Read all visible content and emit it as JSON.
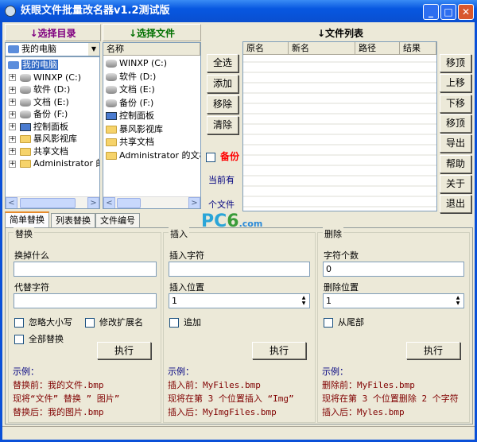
{
  "window": {
    "title": "妖眼文件批量改名器v1.2测试版"
  },
  "dir_panel": {
    "header": "↓选择目录",
    "combo": "我的电脑",
    "tree": [
      {
        "label": "我的电脑",
        "type": "pc"
      },
      {
        "label": "WINXP (C:)",
        "type": "drive"
      },
      {
        "label": "软件 (D:)",
        "type": "drive"
      },
      {
        "label": "文档 (E:)",
        "type": "drive"
      },
      {
        "label": "备份 (F:)",
        "type": "drive"
      },
      {
        "label": "控制面板",
        "type": "cp"
      },
      {
        "label": "暴风影视库",
        "type": "folder"
      },
      {
        "label": "共享文档",
        "type": "folder"
      },
      {
        "label": "Administrator 的文",
        "type": "folder"
      }
    ]
  },
  "file_panel": {
    "header": "↓选择文件",
    "column": "名称",
    "items": [
      {
        "label": "WINXP (C:)",
        "type": "drive"
      },
      {
        "label": "软件 (D:)",
        "type": "drive"
      },
      {
        "label": "文档 (E:)",
        "type": "drive"
      },
      {
        "label": "备份 (F:)",
        "type": "drive"
      },
      {
        "label": "控制面板",
        "type": "cp"
      },
      {
        "label": "暴风影视库",
        "type": "folder"
      },
      {
        "label": "共享文档",
        "type": "folder"
      },
      {
        "label": "Administrator 的文档",
        "type": "folder"
      }
    ]
  },
  "mid_buttons": [
    "全选",
    "添加",
    "移除",
    "清除"
  ],
  "backup_label": "备份",
  "count_prefix": "当前有",
  "count_suffix": "个文件",
  "list": {
    "header": "↓文件列表",
    "columns": [
      "原名",
      "新名",
      "路径",
      "结果"
    ]
  },
  "right_buttons": [
    "移顶",
    "上移",
    "下移",
    "移顶",
    "导出",
    "帮助",
    "关于",
    "退出"
  ],
  "tabs": [
    "简单替换",
    "列表替换",
    "文件编号"
  ],
  "watermark": "PC6下载 .com",
  "replace": {
    "title": "替换",
    "find_label": "换掉什么",
    "find_value": "",
    "with_label": "代替字符",
    "with_value": "",
    "ignore_case": "忽略大小写",
    "modify_ext": "修改扩展名",
    "replace_all": "全部替换",
    "execute": "执行",
    "example_title": "示例：",
    "example": [
      "替换前：我的文件.bmp",
      "现将“文件” 替换 ” 图片”",
      "替换后：我的图片.bmp"
    ]
  },
  "insert": {
    "title": "插入",
    "chars_label": "插入字符",
    "chars_value": "",
    "pos_label": "插入位置",
    "pos_value": "1",
    "append": "追加",
    "execute": "执行",
    "example_title": "示例：",
    "example": [
      "插入前：MyFiles.bmp",
      "现将在第 3 个位置插入 “Img”",
      "插入后：MyImgFiles.bmp"
    ]
  },
  "delete": {
    "title": "删除",
    "count_label": "字符个数",
    "count_value": "0",
    "pos_label": "删除位置",
    "pos_value": "1",
    "from_end": "从尾部",
    "execute": "执行",
    "example_title": "示例：",
    "example": [
      "删除前：MyFiles.bmp",
      "现将在第 3 个位置删除 2 个字符",
      "插入后：Myles.bmp"
    ]
  }
}
